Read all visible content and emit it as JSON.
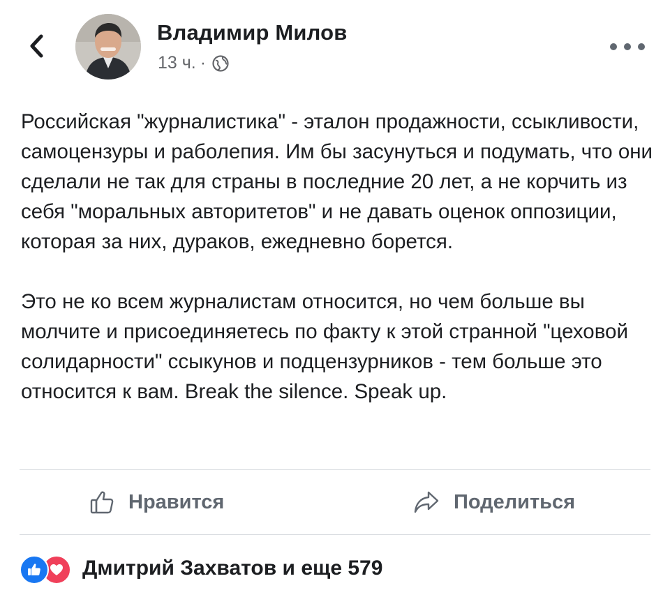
{
  "post": {
    "author": "Владимир Милов",
    "time": "13 ч.",
    "separator": "·",
    "paragraphs": [
      "Российская \"журналистика\" - эталон продажности, ссыкливости, самоцензуры и раболепия. Им бы засунуться и подумать, что они сделали не так для страны в последние 20 лет, а не корчить из себя \"моральных авторитетов\" и не давать оценок оппозиции, которая за них, дураков, ежедневно борется.",
      "Это не ко всем журналистам относится, но чем больше вы молчите и присоединяетесь по факту к этой странной \"цеховой солидарности\" ссыкунов и подцензурников - тем больше это относится к вам. Break the silence. Speak up."
    ]
  },
  "actions": {
    "like_label": "Нравится",
    "share_label": "Поделиться"
  },
  "reactions": {
    "summary": "Дмитрий Захватов и еще 579",
    "icons": [
      "like-reaction-icon",
      "love-reaction-icon"
    ]
  },
  "icons": {
    "back": "chevron-left-icon",
    "privacy": "globe-icon",
    "more": "more-dots-icon"
  },
  "colors": {
    "like_reaction": "#1877f2",
    "love_reaction": "#f0405a",
    "secondary_text": "#65676b"
  }
}
